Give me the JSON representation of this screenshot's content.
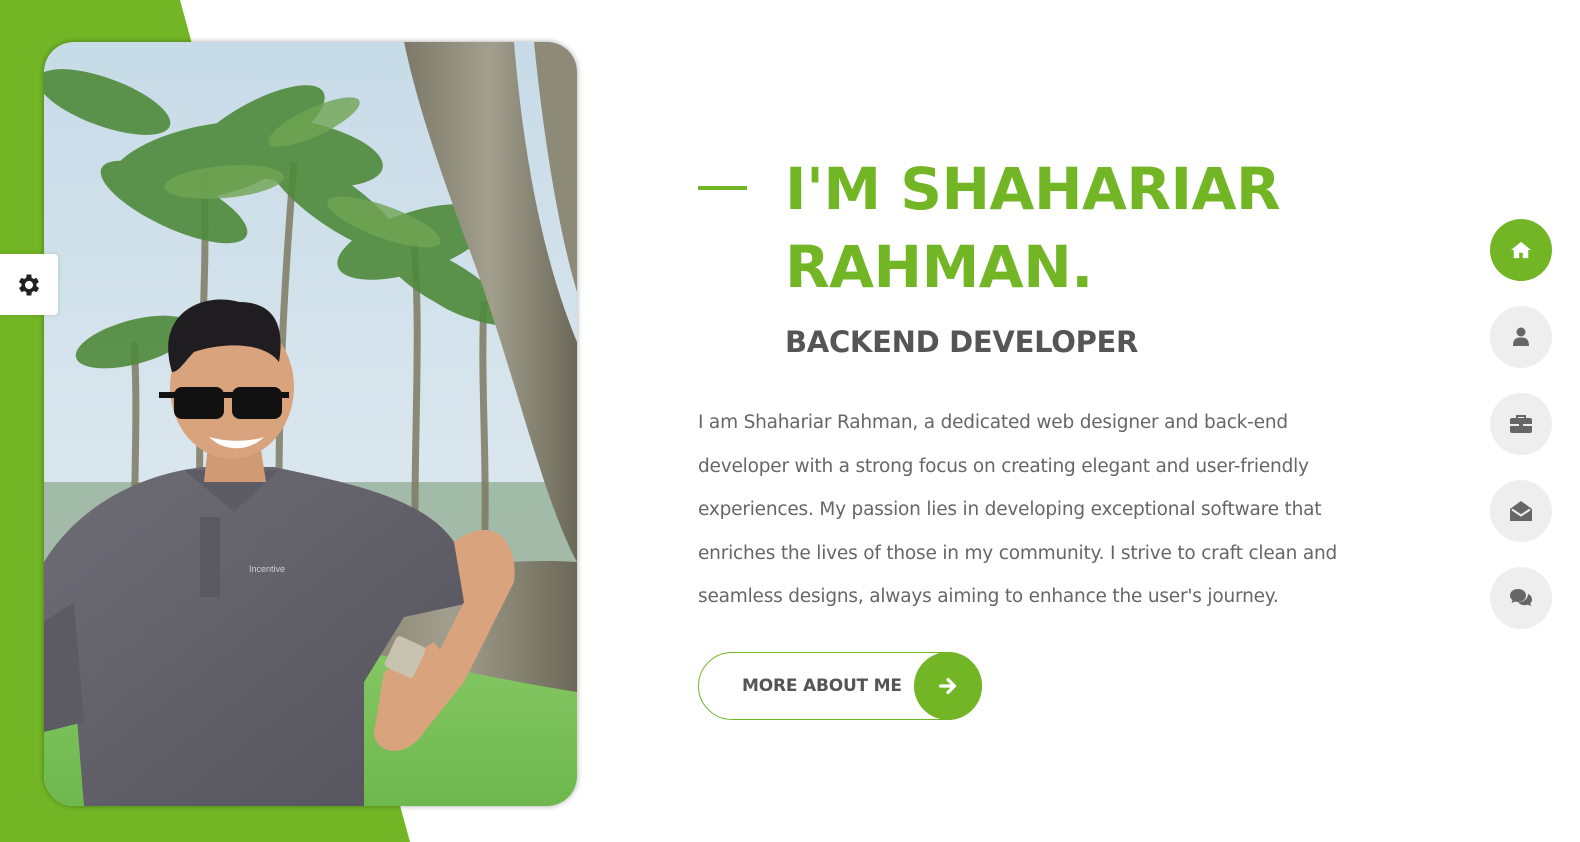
{
  "hero": {
    "title": "I'M SHAHARIAR RAHMAN.",
    "subtitle": "BACKEND DEVELOPER",
    "bio": "I am Shahariar Rahman, a dedicated web designer and back-end developer with a strong focus on creating elegant and user-friendly experiences. My passion lies in developing exceptional software that enriches the lives of those in my community. I strive to craft clean and seamless designs, always aiming to enhance the user's journey.",
    "button_label": "MORE ABOUT ME"
  },
  "side_nav": {
    "items": [
      {
        "icon": "home-icon",
        "active": true
      },
      {
        "icon": "user-icon",
        "active": false
      },
      {
        "icon": "briefcase-icon",
        "active": false
      },
      {
        "icon": "envelope-open-icon",
        "active": false
      },
      {
        "icon": "comments-icon",
        "active": false
      }
    ]
  },
  "settings": {
    "icon": "gear-icon"
  },
  "photo": {
    "subject": "portrait-photo",
    "shirt_logo_text": "Incentive"
  },
  "colors": {
    "accent": "#72b626",
    "heading_dark": "#555555",
    "body_text": "#666666",
    "nav_inactive_bg": "#eeeeee",
    "nav_icon": "#666666"
  }
}
